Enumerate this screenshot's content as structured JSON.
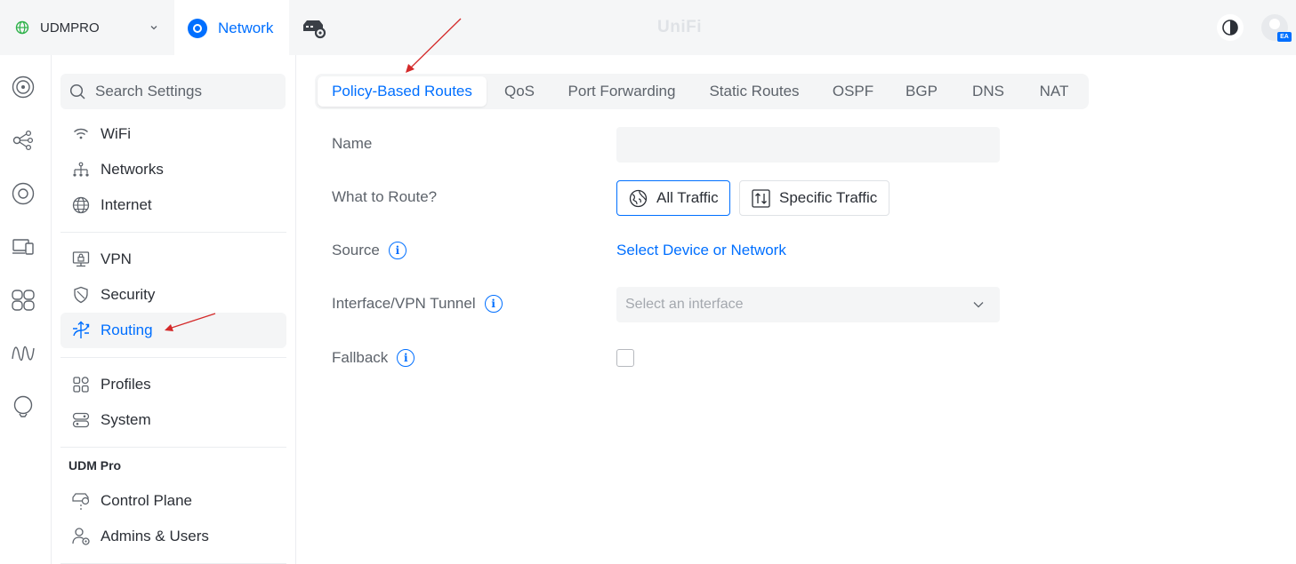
{
  "header": {
    "site_name": "UDMPRO",
    "app_label": "Network",
    "brand": "UniFi",
    "avatar_badge": "EA"
  },
  "search": {
    "placeholder": "Search Settings"
  },
  "nav": {
    "items": [
      {
        "label": "WiFi",
        "icon": "wifi-icon"
      },
      {
        "label": "Networks",
        "icon": "networks-icon"
      },
      {
        "label": "Internet",
        "icon": "globe-icon"
      },
      {
        "label": "VPN",
        "icon": "vpn-icon"
      },
      {
        "label": "Security",
        "icon": "shield-icon"
      },
      {
        "label": "Routing",
        "icon": "routing-icon",
        "active": true
      },
      {
        "label": "Profiles",
        "icon": "profiles-icon"
      },
      {
        "label": "System",
        "icon": "system-icon"
      }
    ],
    "section_title": "UDM Pro",
    "section_items": [
      {
        "label": "Control Plane",
        "icon": "control-plane-icon"
      },
      {
        "label": "Admins & Users",
        "icon": "admins-icon"
      }
    ]
  },
  "tabs": [
    {
      "label": "Policy-Based Routes",
      "active": true
    },
    {
      "label": "QoS"
    },
    {
      "label": "Port Forwarding"
    },
    {
      "label": "Static Routes"
    },
    {
      "label": "OSPF"
    },
    {
      "label": "BGP"
    },
    {
      "label": "DNS"
    },
    {
      "label": "NAT"
    }
  ],
  "form": {
    "name_label": "Name",
    "name_value": "",
    "route_label": "What to Route?",
    "all_traffic": "All Traffic",
    "specific_traffic": "Specific Traffic",
    "selected_route": "All Traffic",
    "source_label": "Source",
    "source_link": "Select Device or Network",
    "interface_label": "Interface/VPN Tunnel",
    "interface_placeholder": "Select an interface",
    "fallback_label": "Fallback",
    "fallback_checked": false,
    "info_glyph": "i"
  },
  "colors": {
    "accent": "#006fff",
    "annotation": "#d42a2a"
  }
}
